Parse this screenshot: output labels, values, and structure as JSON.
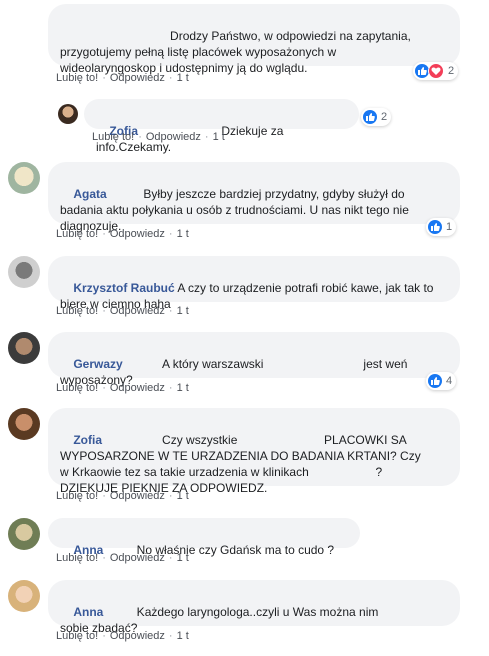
{
  "actions": {
    "like": "Lubię to!",
    "reply": "Odpowiedz",
    "sep": "·",
    "time": "1 t"
  },
  "colors": {
    "author": "#385898",
    "bubble": "#f2f3f5",
    "like": "#1877f2",
    "love": "#f33e58"
  },
  "comments": [
    {
      "id": "c0",
      "author": "",
      "text": "                             Drodzy Państwo, w odpowiedzi na zapytania,\nprzygotujemy pełną listę placówek wyposażonych w\nwideolaryngoskop i udostępnimy ją do wglądu.",
      "reactions": {
        "icons": [
          "like-icon",
          "love-icon"
        ],
        "count": "2"
      }
    },
    {
      "id": "c1",
      "author": "Zofia",
      "text": "                         Dziekuje za info.Czekamy.",
      "reactions": {
        "icons": [
          "like-icon"
        ],
        "count": "2"
      }
    },
    {
      "id": "c2",
      "author": "Agata",
      "text": "           Byłby jeszcze bardziej przydatny, gdyby służył do\nbadania aktu połykania u osób z trudnościami. U nas nikt tego nie\ndiagnozuje.",
      "reactions": {
        "icons": [
          "like-icon"
        ],
        "count": "1"
      }
    },
    {
      "id": "c3",
      "author": "Krzysztof Raubuć",
      "text": " A czy to urządzenie potrafi robić kawe, jak tak to\nbiere w ciemno haha",
      "reactions": null
    },
    {
      "id": "c4",
      "author": "Gerwazy",
      "text": "            A który warszawski                              jest weń\nwyposażony?",
      "reactions": {
        "icons": [
          "like-icon"
        ],
        "count": "4"
      }
    },
    {
      "id": "c5",
      "author": "Zofia",
      "text": "                  Czy wszystkie                          PLACOWKI SA\nWYPOSARZONE W TE URZADZENIA DO BADANIA KRTANI? Czy\nw Krkaowie tez sa takie urzadzenia w klinikach                    ?\nDZIEKUJE PIEKNIE ZA ODPOWIEDZ.",
      "reactions": null
    },
    {
      "id": "c6",
      "author": "Anna",
      "text": "          No właśnie czy Gdańsk ma to cudo ?",
      "reactions": null
    },
    {
      "id": "c7",
      "author": "Anna",
      "text": "          Każdego laryngologa..czyli u Was można nim\nsobie zbadać?",
      "reactions": null
    }
  ]
}
